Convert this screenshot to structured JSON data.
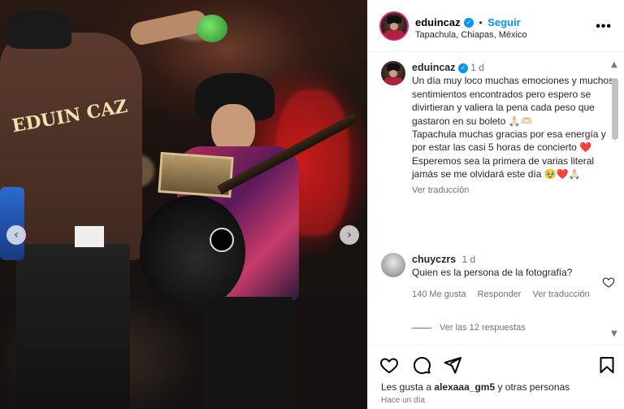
{
  "header": {
    "username": "eduincaz",
    "follow_label": "Seguir",
    "separator": "•",
    "location": "Tapachula, Chiapas, México",
    "more_label": "•••"
  },
  "caption": {
    "username": "eduincaz",
    "age": "1 d",
    "text": "Un día muy loco muchas emociones y muchos sentimientos encontrados pero espero se divirtieran y valiera la pena cada peso que gastaron en su boleto 🙏🏻🫶🏻\nTapachula muchas gracias por esa energía y por estar las casi 5 horas de concierto ❤️\nEsperemos sea la primera de varias literal jamás se me olvidará este día 🥹❤️🙏🏻",
    "see_translation": "Ver traducción"
  },
  "comment": {
    "username": "chuyczrs",
    "age": "1 d",
    "text": "Quien es la persona de la fotografía?",
    "likes": "140 Me gusta",
    "reply": "Responder",
    "see_translation": "Ver traducción",
    "view_replies": "Ver las 12 respuestas"
  },
  "footer": {
    "likes_prefix": "Les gusta a ",
    "likes_user": "alexaaa_gm5",
    "likes_suffix": " y otras personas",
    "time": "Hace un día"
  },
  "photo": {
    "jersey_text": "EDUIN CAZ",
    "nav_prev": "‹",
    "nav_next": "›"
  },
  "icons": {
    "like": "heart-icon",
    "comment": "comment-icon",
    "share": "send-icon",
    "save": "bookmark-icon"
  },
  "colors": {
    "accent": "#0095f6",
    "secondary_text": "#737373",
    "heart_red": "#e0245e"
  }
}
